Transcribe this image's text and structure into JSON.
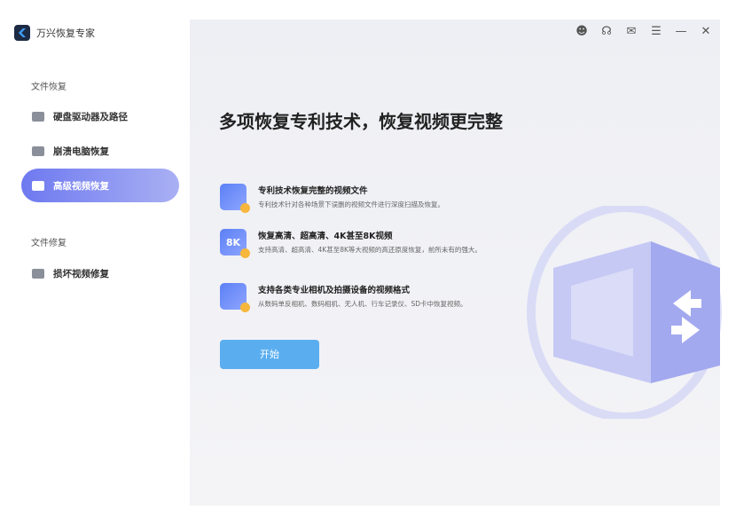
{
  "app": {
    "title": "万兴恢复专家"
  },
  "sidebar": {
    "sections": [
      {
        "label": "文件恢复",
        "items": [
          {
            "label": "硬盘驱动器及路径"
          },
          {
            "label": "崩溃电脑恢复"
          },
          {
            "label": "高级视频恢复"
          }
        ]
      },
      {
        "label": "文件修复",
        "items": [
          {
            "label": "损坏视频修复"
          }
        ]
      }
    ]
  },
  "titlebar": {
    "icons": [
      "user-icon",
      "headset-icon",
      "mail-icon",
      "menu-icon",
      "minimize-icon",
      "close-icon"
    ]
  },
  "main": {
    "title": "多项恢复专利技术，恢复视频更完整",
    "features": [
      {
        "title": "专利技术恢复完整的视频文件",
        "desc": "专利技术针对各种场景下误删的视频文件进行深度扫描及恢复。",
        "icon_text": ""
      },
      {
        "title": "恢复高清、超高清、4K甚至8K视频",
        "desc": "支持高清、超高清、4K甚至8K等大视频的高还原度恢复，前所未有的强大。",
        "icon_text": "8K"
      },
      {
        "title": "支持各类专业相机及拍摄设备的视频格式",
        "desc": "从数码单反相机、数码相机、无人机、行车记录仪、SD卡中恢复视频。",
        "icon_text": ""
      }
    ],
    "start_label": "开始"
  },
  "colors": {
    "accent": "#6e79f0",
    "button": "#5aaef0"
  }
}
